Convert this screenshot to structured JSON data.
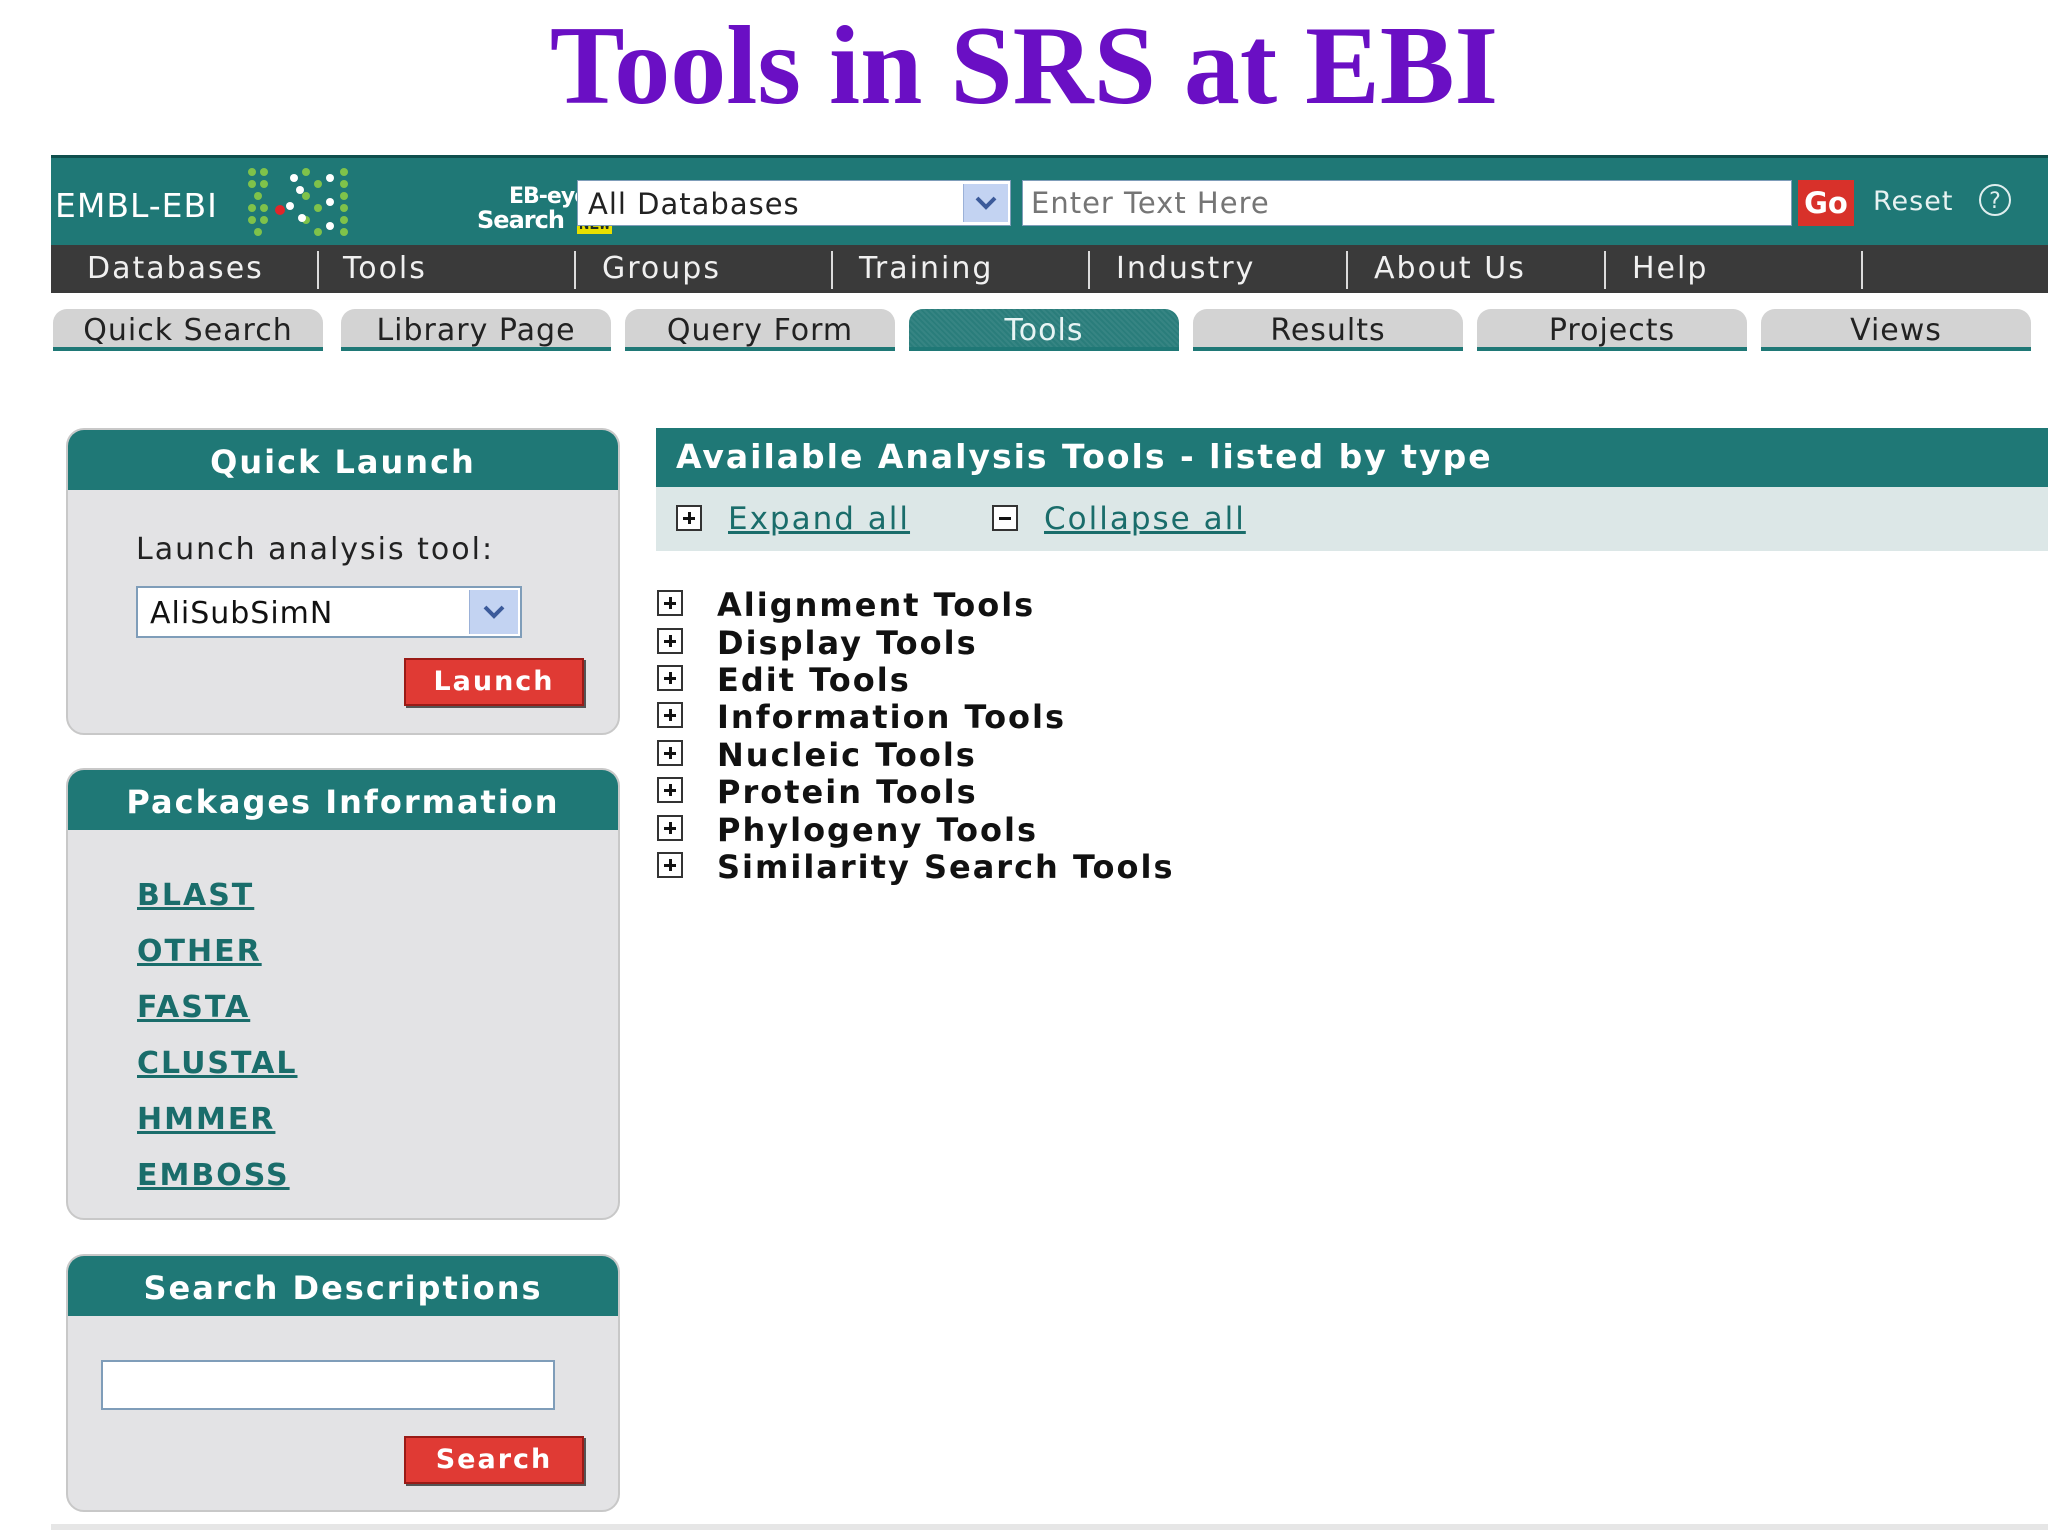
{
  "slide_title": "Tools in SRS at EBI",
  "header": {
    "logo_text": "EMBL-EBI",
    "ebeye_top": "EB-eye",
    "ebeye_bottom": "Search",
    "ebeye_badge": "NEW",
    "database_select": "All Databases",
    "search_placeholder": "Enter Text Here",
    "go_label": "Go",
    "reset_label": "Reset",
    "help_label": "?"
  },
  "nav": {
    "items": [
      {
        "label": "Databases"
      },
      {
        "label": "Tools"
      },
      {
        "label": "Groups"
      },
      {
        "label": "Training"
      },
      {
        "label": "Industry"
      },
      {
        "label": "About Us"
      },
      {
        "label": "Help"
      }
    ]
  },
  "tabs": {
    "items": [
      {
        "label": "Quick Search",
        "active": false
      },
      {
        "label": "Library Page",
        "active": false
      },
      {
        "label": "Query Form",
        "active": false
      },
      {
        "label": "Tools",
        "active": true
      },
      {
        "label": "Results",
        "active": false
      },
      {
        "label": "Projects",
        "active": false
      },
      {
        "label": "Views",
        "active": false
      }
    ]
  },
  "quick_launch": {
    "title": "Quick Launch",
    "label": "Launch analysis tool:",
    "selected_tool": "AliSubSimN",
    "launch_label": "Launch"
  },
  "packages": {
    "title": "Packages Information",
    "links": [
      "BLAST",
      "OTHER",
      "FASTA",
      "CLUSTAL",
      "HMMER",
      "EMBOSS"
    ]
  },
  "search_descriptions": {
    "title": "Search Descriptions",
    "input_value": "",
    "search_label": "Search"
  },
  "main": {
    "title": "Available Analysis Tools - listed by type",
    "expand_all": "Expand all",
    "collapse_all": "Collapse all",
    "tool_types": [
      "Alignment Tools",
      "Display Tools",
      "Edit Tools",
      "Information Tools",
      "Nucleic Tools",
      "Protein Tools",
      "Phylogeny Tools",
      "Similarity Search Tools"
    ]
  },
  "colors": {
    "title_purple": "#6a0fc4",
    "header_teal": "#1f7876",
    "nav_dark": "#3a3a3a",
    "button_red": "#e03a34",
    "link_teal": "#1a6d6b"
  }
}
